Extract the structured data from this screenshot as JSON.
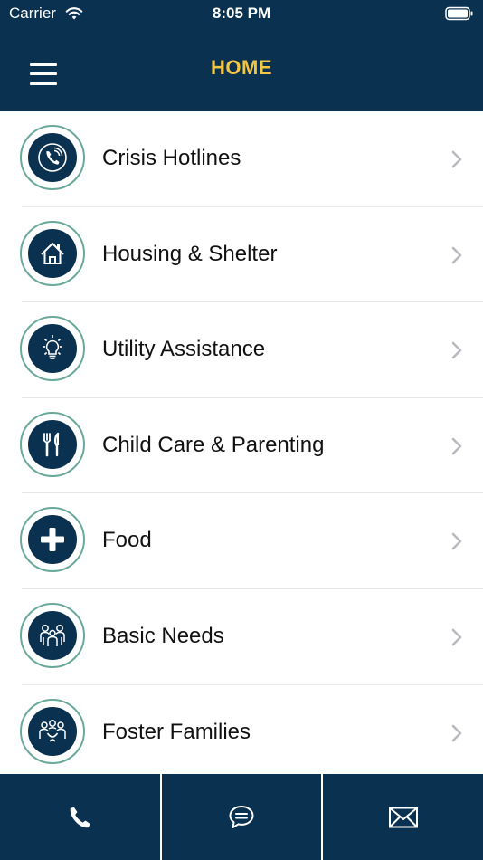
{
  "status_bar": {
    "carrier": "Carrier",
    "time": "8:05 PM"
  },
  "nav": {
    "title": "HOME",
    "title_color": "#f3c744",
    "background": "#0b3150"
  },
  "list": {
    "items": [
      {
        "label": "Crisis Hotlines",
        "icon": "phone-icon"
      },
      {
        "label": "Housing & Shelter",
        "icon": "house-icon"
      },
      {
        "label": "Utility Assistance",
        "icon": "lightbulb-icon"
      },
      {
        "label": "Child Care & Parenting",
        "icon": "fork-knife-icon"
      },
      {
        "label": "Food",
        "icon": "plus-icon"
      },
      {
        "label": "Basic Needs",
        "icon": "people-icon"
      },
      {
        "label": "Foster Families",
        "icon": "family-icon"
      }
    ]
  },
  "bottom_bar": {
    "buttons": [
      {
        "icon": "phone-icon"
      },
      {
        "icon": "chat-bubble-icon"
      },
      {
        "icon": "mail-icon"
      }
    ]
  }
}
